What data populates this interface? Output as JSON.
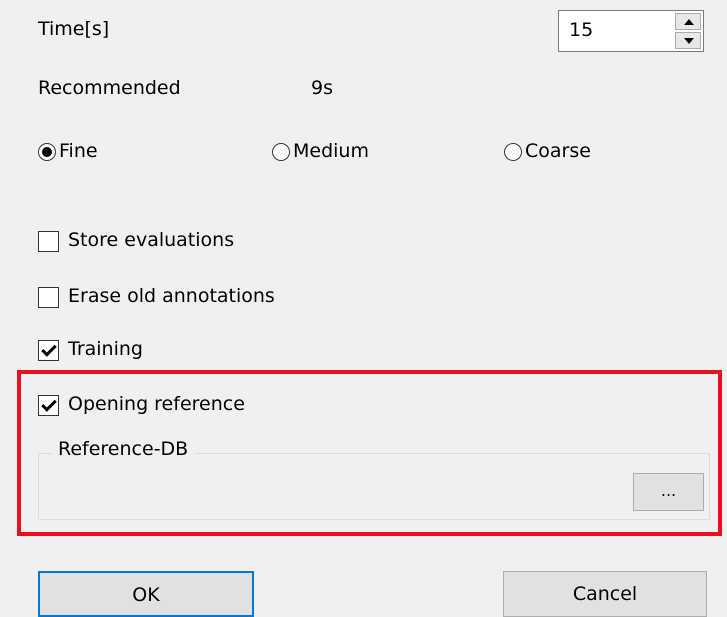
{
  "time": {
    "label": "Time[s]",
    "value": "15"
  },
  "recommended": {
    "label": "Recommended",
    "value": "9s"
  },
  "precision": {
    "selected": "Fine",
    "options": [
      "Fine",
      "Medium",
      "Coarse"
    ]
  },
  "options": {
    "store_evaluations": {
      "label": "Store evaluations",
      "checked": false
    },
    "erase_old_annotations": {
      "label": "Erase old annotations",
      "checked": false
    },
    "training": {
      "label": "Training",
      "checked": true
    },
    "opening_reference": {
      "label": "Opening reference",
      "checked": true
    }
  },
  "reference_db": {
    "title": "Reference-DB",
    "browse_label": "..."
  },
  "buttons": {
    "ok": "OK",
    "cancel": "Cancel"
  },
  "colors": {
    "highlight": "#e8101e",
    "focus_border": "#0078d7"
  }
}
